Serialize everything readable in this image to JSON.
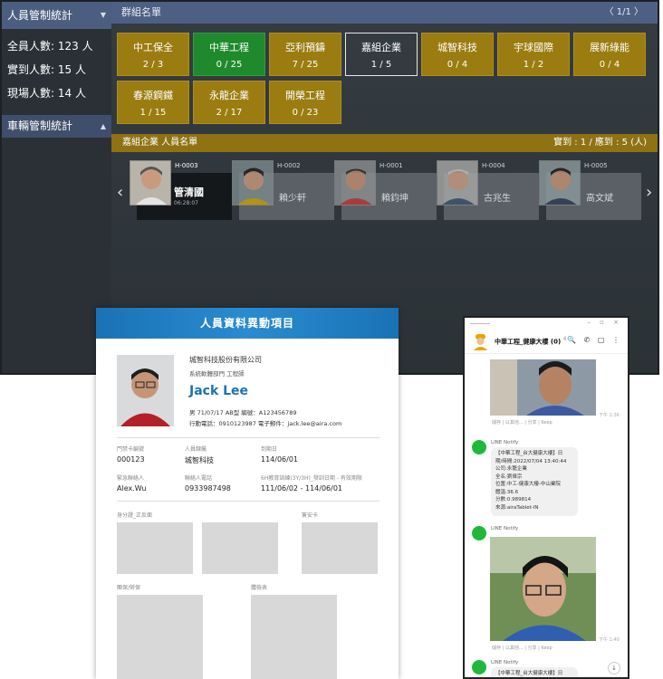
{
  "sidebar": {
    "personnel_title": "人員管制統計",
    "stats": [
      "全員人數: 123 人",
      "實到人數: 15 人",
      "現場人數: 14 人"
    ],
    "vehicle_title": "車輛管制統計"
  },
  "groups_panel": {
    "title": "群組名單",
    "pager": "〈 1/1 〉",
    "groups": [
      {
        "name": "中工保全",
        "count": "2 / 3",
        "state": "normal"
      },
      {
        "name": "中華工程",
        "count": "0 / 25",
        "state": "green"
      },
      {
        "name": "亞利預鑄",
        "count": "7 / 25",
        "state": "normal"
      },
      {
        "name": "嘉組企業",
        "count": "1 / 5",
        "state": "selected"
      },
      {
        "name": "城智科技",
        "count": "0 / 4",
        "state": "normal"
      },
      {
        "name": "宇球國際",
        "count": "1 / 2",
        "state": "normal"
      },
      {
        "name": "展新綠能",
        "count": "0 / 4",
        "state": "normal"
      },
      {
        "name": "春源鋼鐵",
        "count": "1 / 15",
        "state": "normal"
      },
      {
        "name": "永龍企業",
        "count": "2 / 17",
        "state": "normal"
      },
      {
        "name": "開榮工程",
        "count": "0 / 23",
        "state": "normal"
      }
    ]
  },
  "roster": {
    "title": "嘉組企業 人員名單",
    "summary": "實到 : 1 / 應到 : 5 (人)",
    "prev": "‹",
    "next": "›",
    "people": [
      {
        "id": "H-0003",
        "name": "管清國",
        "time": "06:28:07"
      },
      {
        "id": "H-0002",
        "name": "賴少軒"
      },
      {
        "id": "H-0001",
        "name": "賴鈞坤"
      },
      {
        "id": "H-0004",
        "name": "古兆生"
      },
      {
        "id": "H-0005",
        "name": "高文斌"
      }
    ]
  },
  "employee_card": {
    "header": "人員資料異動項目",
    "company": "城智科技股份有限公司",
    "dept": "系統軟體部門 工程師",
    "name": "Jack Lee",
    "line1": "男    71/07/17    AB型        編號：A123456789",
    "line2": "行動電話：0910123987        電子郵件：jack.lee@aira.com",
    "fields_row1": [
      {
        "label": "門禁卡編號",
        "value": "000123"
      },
      {
        "label": "人員隸屬",
        "value": "城智科技"
      },
      {
        "label": "到期日",
        "value": "114/06/01"
      }
    ],
    "fields_row2": [
      {
        "label": "緊急聯絡人",
        "value": "Alex.Wu"
      },
      {
        "label": "聯絡人電話",
        "value": "0933987498"
      },
      {
        "label": "6H教育訓練(3Y/3H)_發訓日期 - 有效期限",
        "value": "111/06/02 - 114/06/01"
      }
    ],
    "doc_labels": {
      "id_card": "身分證_正反面",
      "consent": "簽安卡",
      "insurance": "團保/勞保",
      "health": "體檢表"
    }
  },
  "chat": {
    "title": "中華工程_健康大樓 (0)",
    "title_sup": "4",
    "tools": "🔍 ✆ ▢ ⋮",
    "window_ctrls": "– ▫ ×",
    "meta1": "儲存 | 以其他... | 分享 | Keep",
    "time1": "下午 1:36",
    "bot_name": "LINE Notify",
    "notify_lines": [
      "【中華工程_台大健康大樓】日",
      "期/時間:2022/07/04 13:40:44",
      "公司:永龍企業",
      "全名:劉偉宗",
      "位置:中工-健康大樓-中山業院",
      "體溫:36.6",
      "分數:0.989814",
      "來源:airaTablet-IN"
    ],
    "meta2": "儲存 | 以其他... | 分享 | Keep",
    "time2": "下午 1:40",
    "bot_name2": "LINE Notify",
    "bot_name3": "LINE Notify",
    "last_preview": "【中華工程_台大健康大樓】日",
    "scroll_down": "↓"
  }
}
